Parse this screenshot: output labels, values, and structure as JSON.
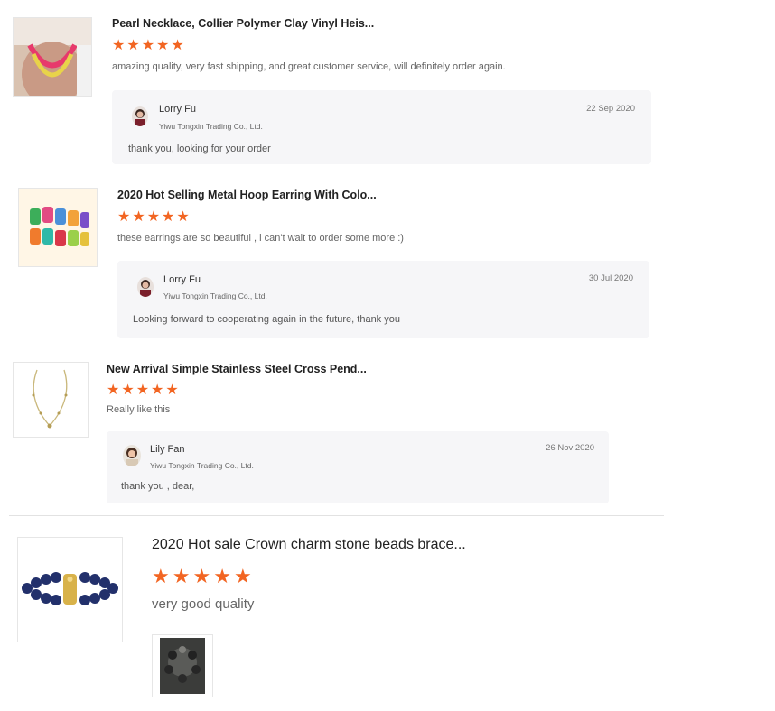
{
  "reviews": [
    {
      "title": "Pearl Necklace, Collier Polymer Clay Vinyl Heis...",
      "stars": 5,
      "comment": "amazing quality, very fast shipping, and great customer service, will definitely order again.",
      "reply": {
        "name": "Lorry Fu",
        "company": "Yiwu Tongxin Trading Co., Ltd.",
        "date": "22 Sep 2020",
        "text": "thank you, looking for your order"
      }
    },
    {
      "title": "2020 Hot Selling Metal Hoop Earring With Colo...",
      "stars": 5,
      "comment": "these earrings are so beautiful , i can't wait to order some more :)",
      "reply": {
        "name": "Lorry Fu",
        "company": "Yiwu Tongxin Trading Co., Ltd.",
        "date": "30 Jul 2020",
        "text": "Looking forward to cooperating again in the future, thank you"
      }
    },
    {
      "title": "New Arrival Simple Stainless Steel Cross Pend...",
      "stars": 5,
      "comment": "Really like this",
      "reply": {
        "name": "Lily Fan",
        "company": "Yiwu Tongxin Trading Co., Ltd.",
        "date": "26 Nov 2020",
        "text": "thank you , dear,"
      }
    },
    {
      "title": "2020 Hot sale Crown charm stone beads brace...",
      "stars": 5,
      "comment": "very good quality"
    }
  ],
  "colors": {
    "star": "#f26522",
    "reply_bg": "#f6f6f8"
  }
}
